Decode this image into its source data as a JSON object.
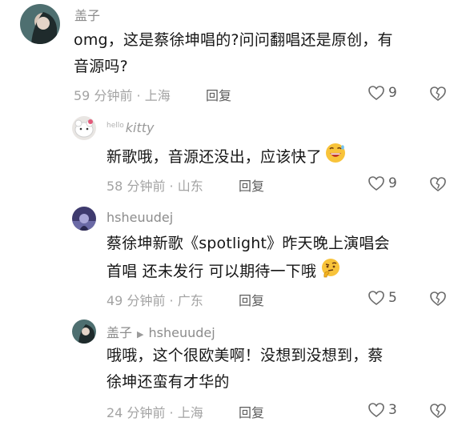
{
  "comments": [
    {
      "author": "盖子",
      "lines": [
        "omg，这是蔡徐坤唱的?问问翻唱还是原创，有",
        "音源吗?"
      ],
      "meta": "59 分钟前 · 上海",
      "reply_label": "回复",
      "likes": "9"
    },
    {
      "author_prefix": "hello",
      "author": "kitty",
      "lines": [
        "新歌哦，音源还没出，应该快了"
      ],
      "emoji": "grinning-sweat-emoji",
      "meta": "58 分钟前 · 山东",
      "reply_label": "回复",
      "likes": "9"
    },
    {
      "author": "hsheuudej",
      "lines": [
        "蔡徐坤新歌《spotlight》昨天晚上演唱会",
        "首唱 还未发行 可以期待一下哦"
      ],
      "emoji": "thinking-face-emoji",
      "meta": "49 分钟前 · 广东",
      "reply_label": "回复",
      "likes": "5"
    },
    {
      "author": "盖子",
      "reply_to": "hsheuudej",
      "lines": [
        "哦哦，这个很欧美啊！没想到没想到，蔡",
        "徐坤还蛮有才华的"
      ],
      "meta": "24 分钟前 · 上海",
      "reply_label": "回复",
      "likes": "3"
    }
  ],
  "icons": {
    "like": "heart-outline-icon",
    "dislike": "heart-broken-icon",
    "reply_arrow": "triangle-right-icon"
  }
}
